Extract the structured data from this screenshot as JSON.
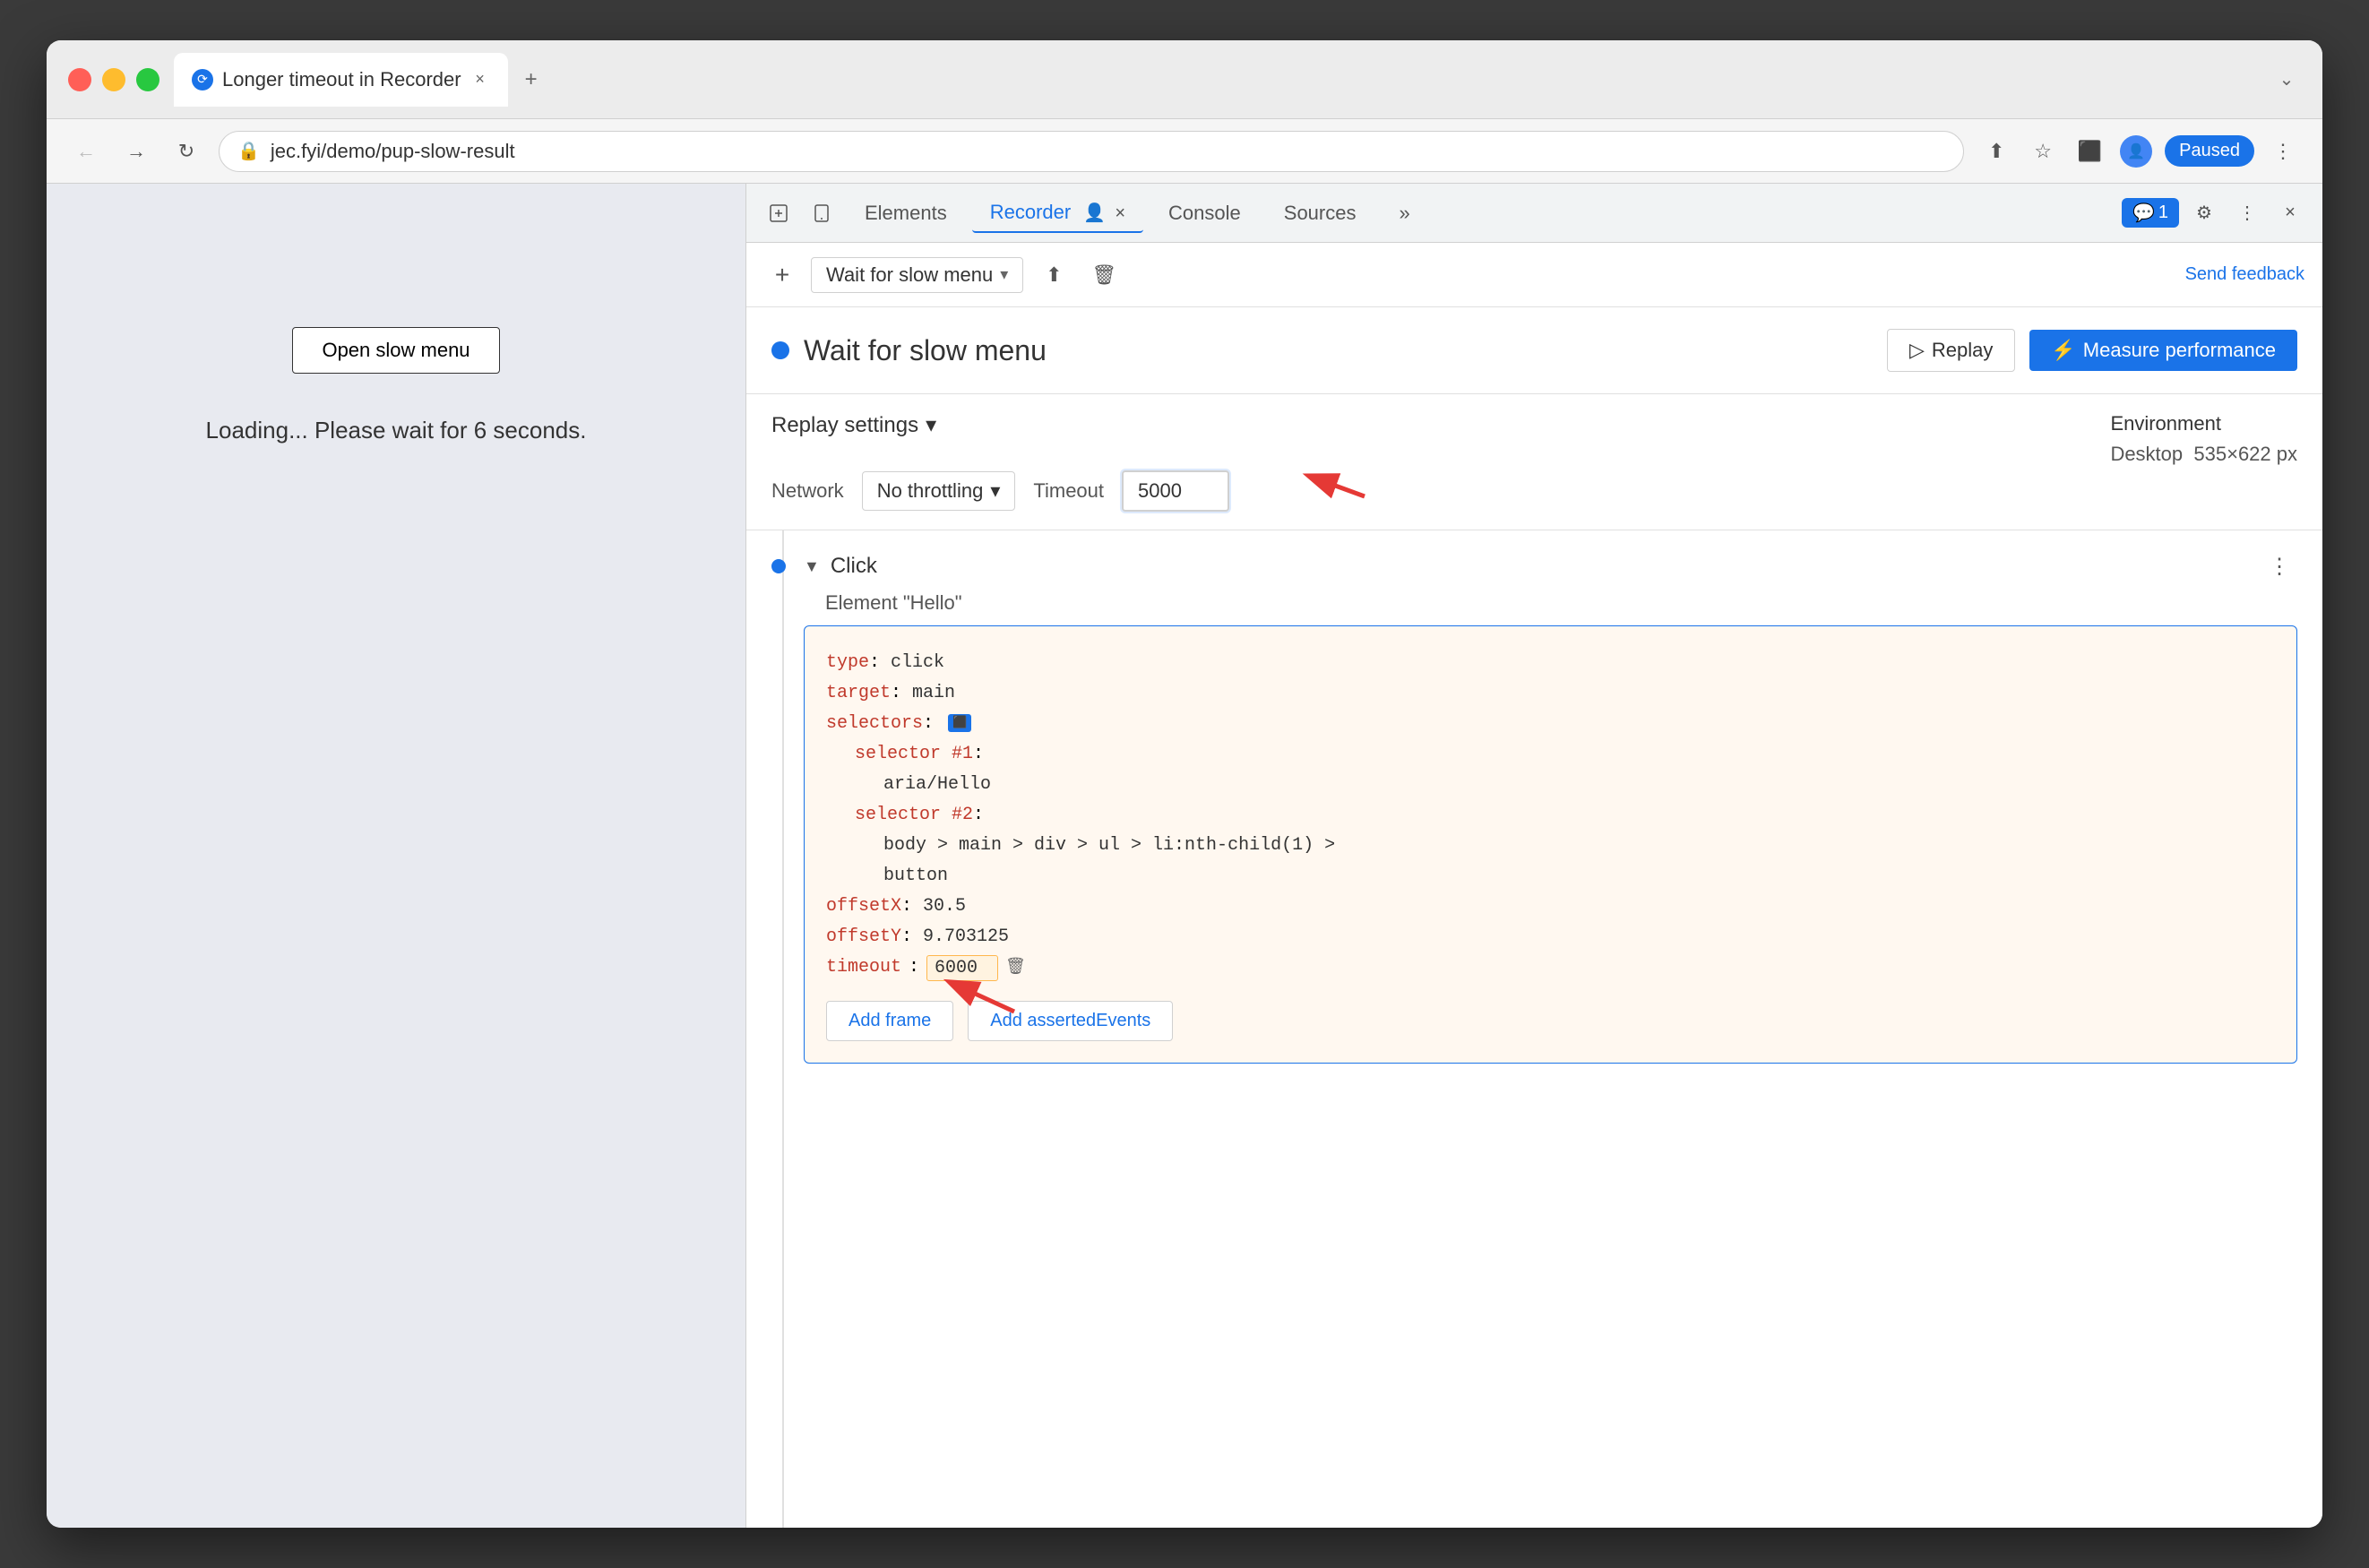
{
  "browser": {
    "title": "Longer timeout in Recorder",
    "tab_close": "×",
    "new_tab": "+",
    "url": "jec.fyi/demo/pup-slow-result",
    "paused_label": "Paused",
    "window_controls": "›"
  },
  "nav": {
    "back": "←",
    "forward": "→",
    "reload": "↻"
  },
  "toolbar_icons": {
    "share": "⬆",
    "bookmark": "☆",
    "extensions": "⬛",
    "profile": "👤",
    "more": "⋮"
  },
  "page": {
    "open_slow_menu_btn": "Open slow menu",
    "loading_text": "Loading... Please wait for 6 seconds."
  },
  "devtools": {
    "tabs": [
      {
        "label": "Elements",
        "active": false
      },
      {
        "label": "Recorder",
        "active": true
      },
      {
        "label": "Console",
        "active": false
      },
      {
        "label": "Sources",
        "active": false
      }
    ],
    "more_tabs": "»",
    "chat_badge": "1",
    "settings_icon": "⚙",
    "more_icon": "⋮",
    "close_icon": "×",
    "inspect_icon": "⬛",
    "device_icon": "📱"
  },
  "recorder": {
    "toolbar": {
      "add_btn": "+",
      "recording_name": "Wait for slow menu",
      "chevron": "▾",
      "export_icon": "⬆",
      "delete_icon": "🗑",
      "send_feedback": "Send feedback"
    },
    "header": {
      "blue_dot": true,
      "title": "Wait for slow menu",
      "replay_btn": "Replay",
      "replay_icon": "▷",
      "measure_btn": "Measure performance",
      "measure_icon": "⚡"
    },
    "replay_settings": {
      "title": "Replay settings",
      "chevron": "▾",
      "network_label": "Network",
      "network_value": "No throttling",
      "network_chevron": "▾",
      "timeout_label": "Timeout",
      "timeout_value": "5000"
    },
    "environment": {
      "title": "Environment",
      "value": "Desktop",
      "size": "535×622 px"
    },
    "step": {
      "type": "Click",
      "element": "Element \"Hello\"",
      "more_icon": "⋮",
      "code": {
        "type_key": "type",
        "type_val": "click",
        "target_key": "target",
        "target_val": "main",
        "selectors_key": "selectors",
        "selector1_key": "selector #1",
        "selector1_val": "aria/Hello",
        "selector2_key": "selector #2",
        "selector2_val": "body > main > div > ul > li:nth-child(1) >",
        "selector2_cont": "button",
        "offsetX_key": "offsetX",
        "offsetX_val": "30.5",
        "offsetY_key": "offsetY",
        "offsetY_val": "9.703125",
        "timeout_key": "timeout",
        "timeout_val": "6000",
        "add_frame_btn": "Add frame",
        "add_asserted_btn": "Add assertedEvents"
      }
    }
  },
  "red_arrow_timeout_label": "→",
  "red_arrow_code_label": "→"
}
